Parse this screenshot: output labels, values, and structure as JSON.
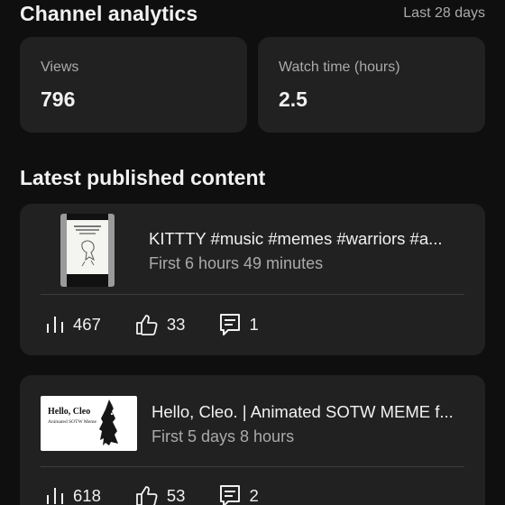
{
  "header": {
    "title": "Channel analytics",
    "period": "Last 28 days"
  },
  "metrics": [
    {
      "label": "Views",
      "value": "796"
    },
    {
      "label": "Watch time (hours)",
      "value": "2.5"
    }
  ],
  "latest": {
    "section_title": "Latest published content",
    "items": [
      {
        "title": "KITTTY #music #memes #warriors #a...",
        "subtitle": "First 6 hours 49 minutes",
        "thumbnail_type": "vertical",
        "views": "467",
        "likes": "33",
        "comments": "1"
      },
      {
        "title": "Hello, Cleo. | Animated SOTW MEME f...",
        "subtitle": "First 5 days 8 hours",
        "thumbnail_type": "horizontal",
        "thumbnail_text": "Hello, Cleo",
        "thumbnail_subtext": "Animated SOTW Meme",
        "views": "618",
        "likes": "53",
        "comments": "2"
      }
    ]
  },
  "icons": {
    "views": "bar-chart-icon",
    "likes": "thumbs-up-icon",
    "comments": "comment-icon"
  },
  "colors": {
    "background": "#0f0f0f",
    "card": "#212121",
    "primary_text": "#f1f1f1",
    "secondary_text": "#aaaaaa"
  }
}
